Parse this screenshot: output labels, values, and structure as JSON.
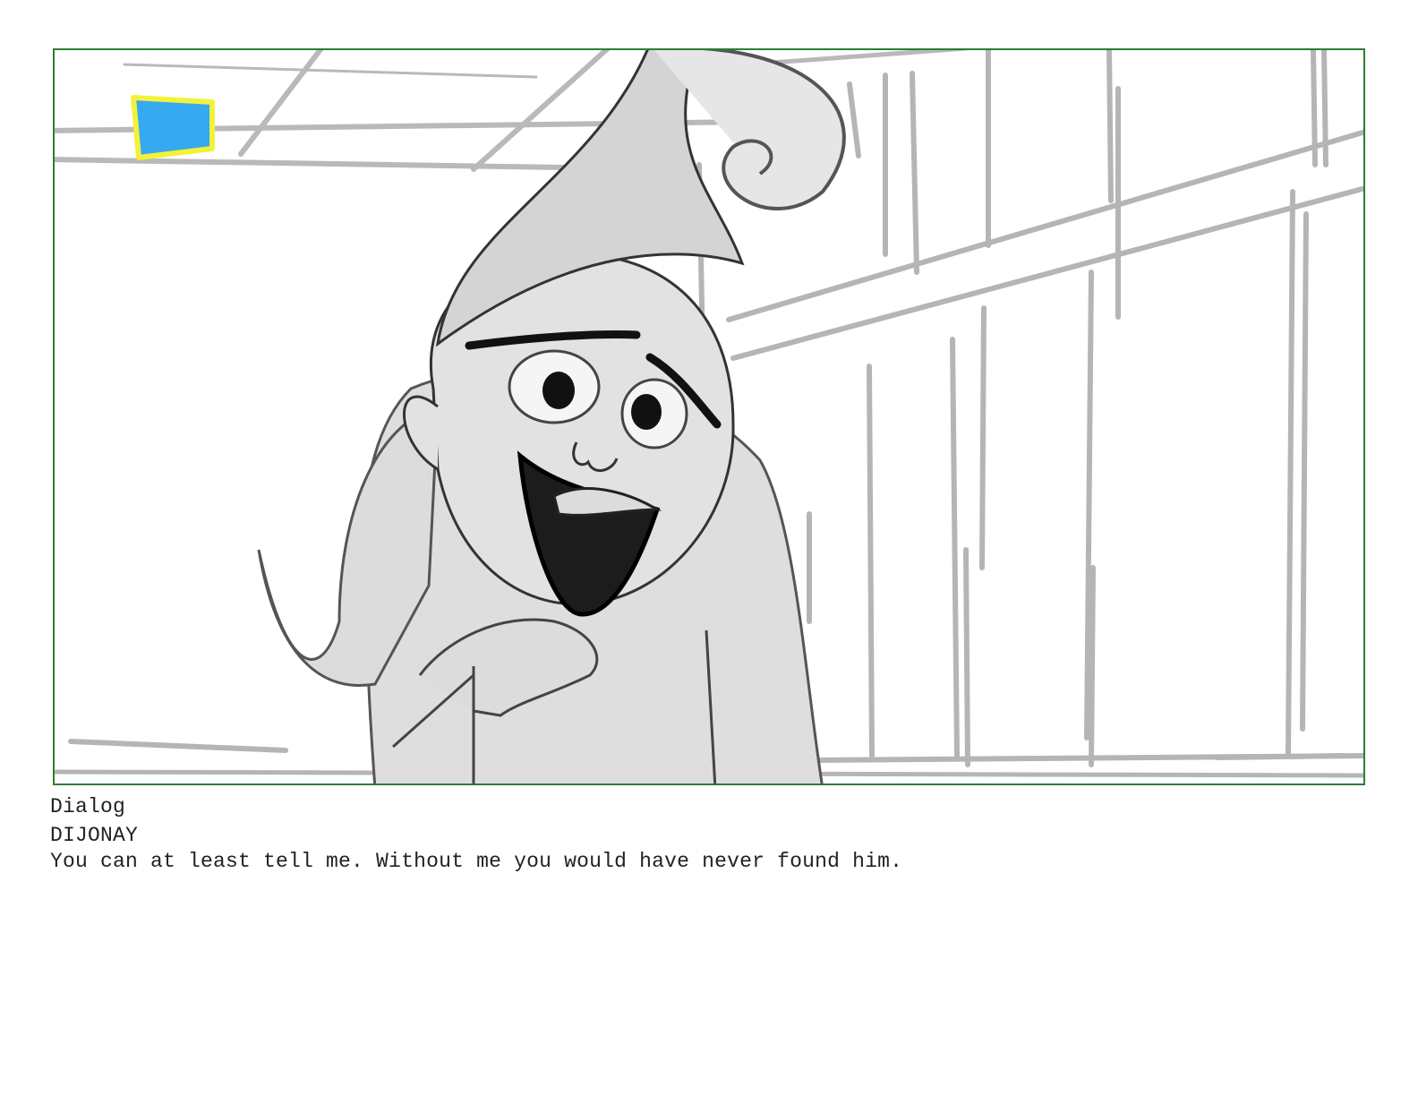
{
  "storyboard_panel": {
    "frame_color": "#2e7d32",
    "ceiling_marker_color": "#36a9f0",
    "ceiling_marker_outline_color": "#f2f23a"
  },
  "caption": {
    "section_label": "Dialog",
    "character": "DIJONAY",
    "line": "You can at least tell me. Without me you would have never found him."
  }
}
